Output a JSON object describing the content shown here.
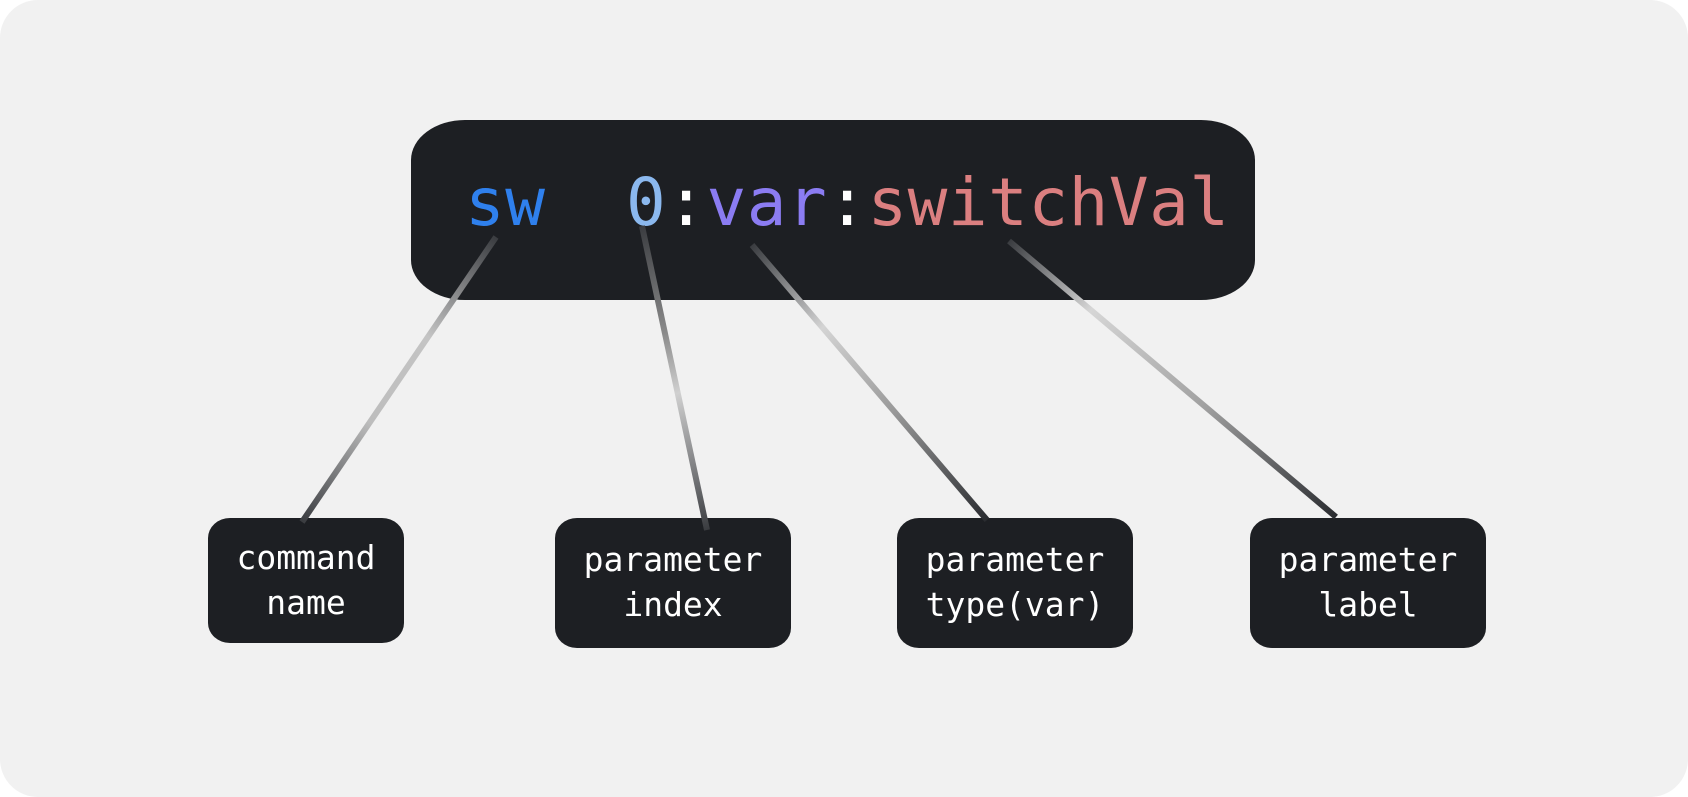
{
  "command": {
    "name": "sw",
    "spacer": "  ",
    "index": "0",
    "sep1": ":",
    "type": "var",
    "sep2": ":",
    "label": "switchVal"
  },
  "labels": {
    "command_name": "command\nname",
    "parameter_index": "parameter\nindex",
    "parameter_type": "parameter\ntype(var)",
    "parameter_label": "parameter\nlabel"
  },
  "colors": {
    "background": "#f1f1f1",
    "box": "#1d1f23",
    "name": "#2f80ed",
    "index": "#8bb8ee",
    "type": "#8b7cf2",
    "label": "#db7f80",
    "label_text": "#ffffff"
  }
}
